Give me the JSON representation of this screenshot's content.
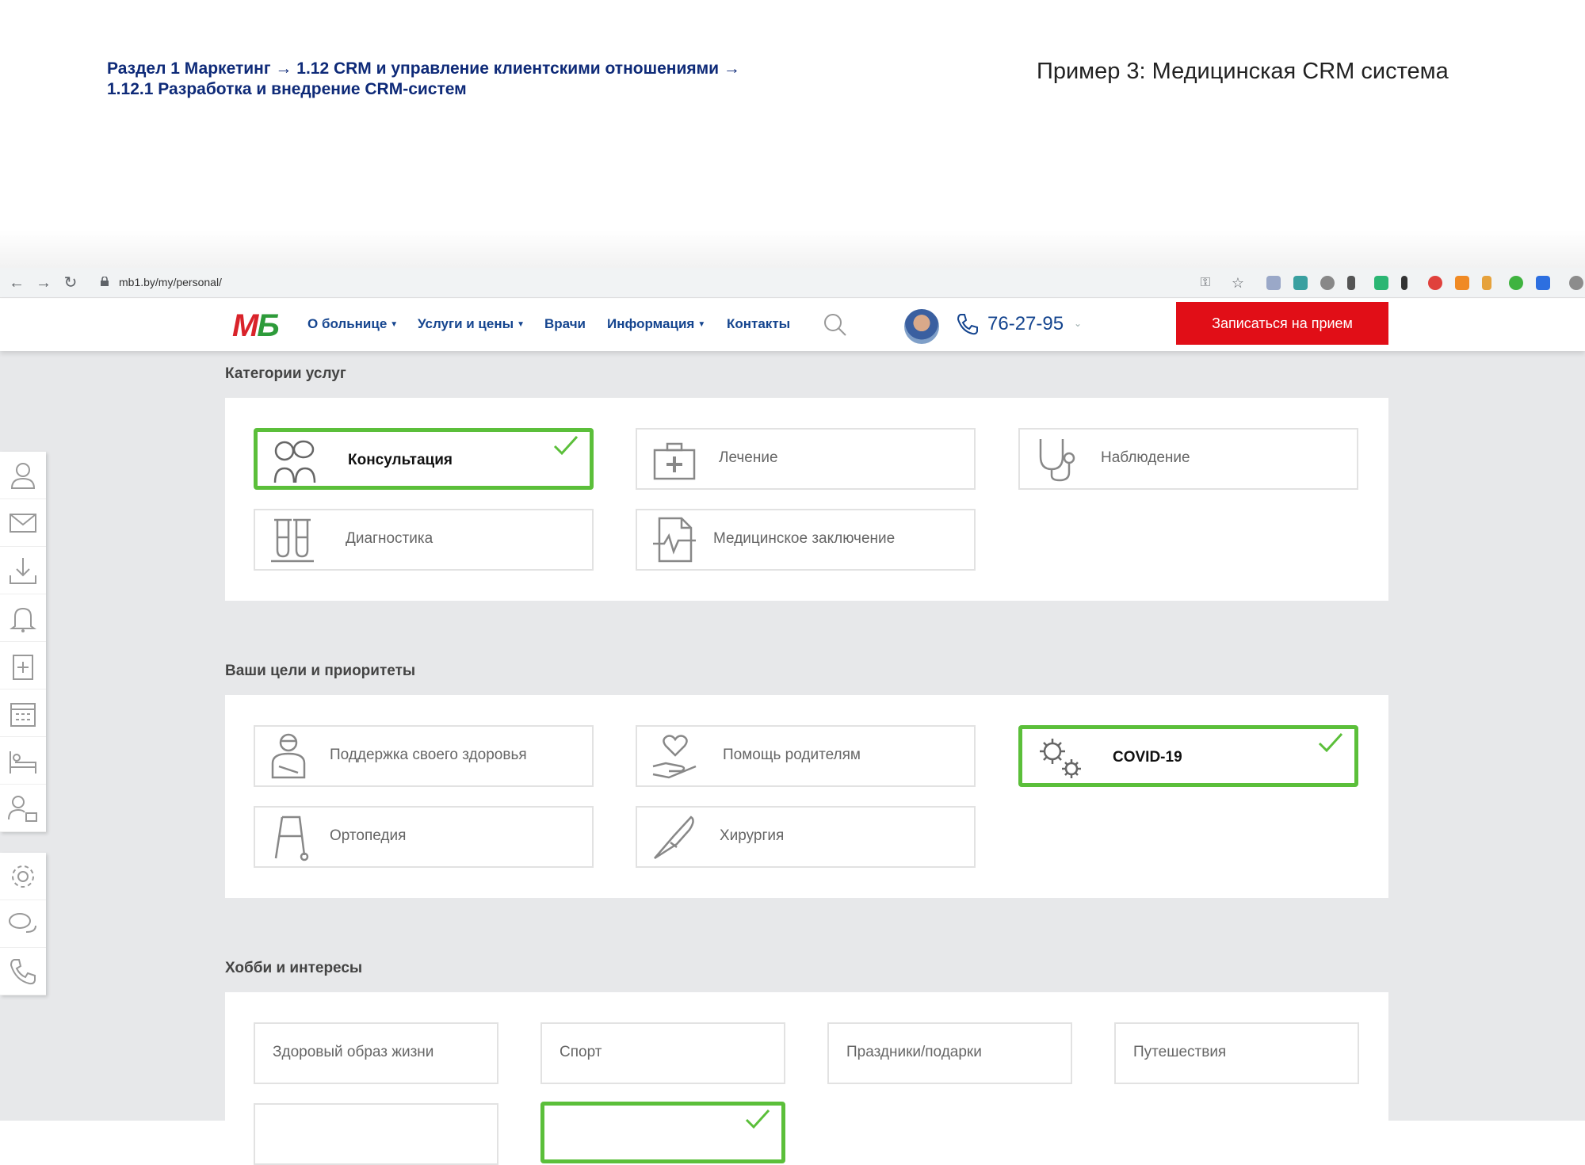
{
  "doc": {
    "breadcrumb_line1": "Раздел 1 Маркетинг  → 1.12 CRM и управление клиентскими отношениями →",
    "breadcrumb_line2": "1.12.1 Разработка и внедрение CRM-систем",
    "example_title": "Пример 3: Медицинская CRM система"
  },
  "browser": {
    "url": "mb1.by/my/personal/"
  },
  "site": {
    "logo": {
      "m": "М",
      "b": "Б"
    },
    "menu": [
      {
        "label": "О больнице",
        "dropdown": true
      },
      {
        "label": "Услуги и цены",
        "dropdown": true
      },
      {
        "label": "Врачи",
        "dropdown": false
      },
      {
        "label": "Информация",
        "dropdown": true
      },
      {
        "label": "Контакты",
        "dropdown": false
      }
    ],
    "phone": "76-27-95",
    "book_button": "Записаться на прием",
    "colors": {
      "accent": "#e10e17",
      "brand_green": "#2d9b3a",
      "selected": "#5bbf3a",
      "link": "#15458f"
    }
  },
  "sections": {
    "categories": {
      "title": "Категории услуг",
      "items": [
        {
          "label": "Консультация",
          "icon": "doctors-icon",
          "selected": true
        },
        {
          "label": "Лечение",
          "icon": "first-aid-icon",
          "selected": false
        },
        {
          "label": "Наблюдение",
          "icon": "stethoscope-icon",
          "selected": false
        },
        {
          "label": "Диагностика",
          "icon": "test-tubes-icon",
          "selected": false
        },
        {
          "label": "Медицинское заключение",
          "icon": "medical-report-icon",
          "selected": false
        }
      ]
    },
    "goals": {
      "title": "Ваши цели и приоритеты",
      "items": [
        {
          "label": "Поддержка своего здоровья",
          "icon": "patient-icon",
          "selected": false
        },
        {
          "label": "Помощь родителям",
          "icon": "heart-hand-icon",
          "selected": false
        },
        {
          "label": "COVID-19",
          "icon": "virus-icon",
          "selected": true
        },
        {
          "label": "Ортопедия",
          "icon": "walker-icon",
          "selected": false
        },
        {
          "label": "Хирургия",
          "icon": "scalpel-icon",
          "selected": false
        }
      ]
    },
    "hobbies": {
      "title": "Хобби и интересы",
      "items": [
        {
          "label": "Здоровый образ жизни",
          "selected": false
        },
        {
          "label": "Спорт",
          "selected": false
        },
        {
          "label": "Праздники/подарки",
          "selected": false
        },
        {
          "label": "Путешествия",
          "selected": false
        },
        {
          "label": "",
          "selected": false
        },
        {
          "label": "",
          "selected": true
        }
      ]
    }
  },
  "sidebar_icons": [
    [
      "user-icon",
      "mail-icon",
      "download-icon",
      "bell-icon",
      "clipboard-plus-icon",
      "calendar-icon",
      "hospital-bed-icon",
      "user-lock-icon"
    ],
    [
      "gear-icon",
      "chat-icon",
      "phone-icon"
    ]
  ]
}
